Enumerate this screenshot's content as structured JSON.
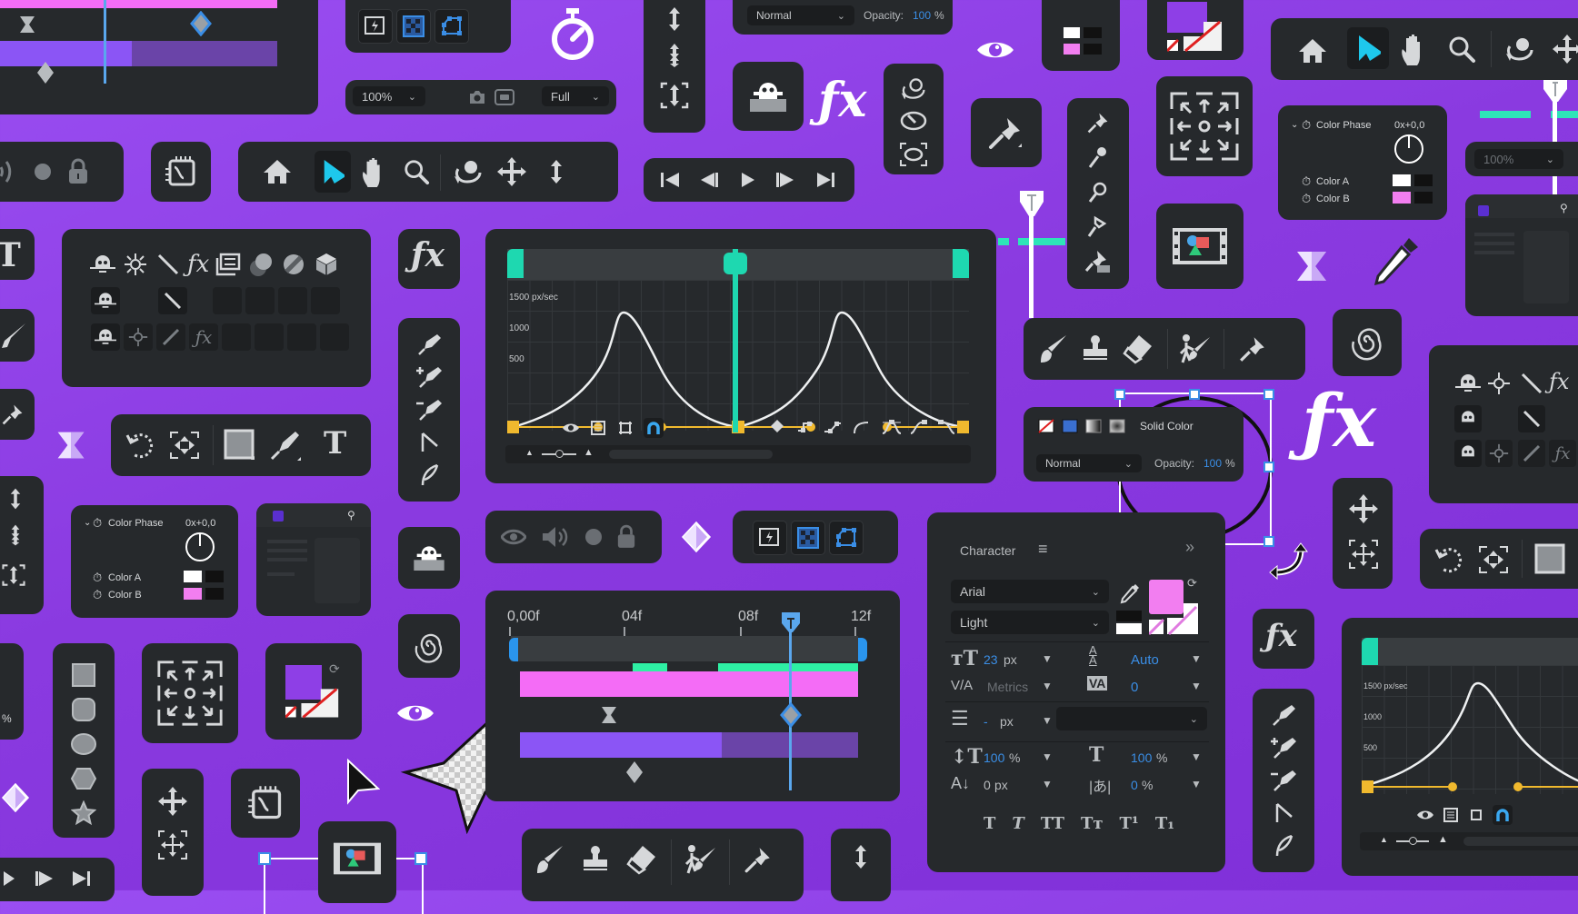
{
  "theme": {
    "background": "#8e3fe6",
    "panel": "#26292c",
    "accent_teal": "#1ed8b0",
    "accent_blue": "#3a8ee6",
    "accent_pink": "#f46cf6",
    "accent_purple": "#8b55f5",
    "accent_yellow": "#f0b92e",
    "selected_tool": "#1ec8ec"
  },
  "blend_panel_top": {
    "mode": "Normal",
    "opacity_label": "Opacity:",
    "opacity_value": "100",
    "opacity_unit": "%"
  },
  "viewer_bar": {
    "zoom": "100%",
    "resolution": "Full"
  },
  "graph_editor": {
    "y_labels": [
      "1500 px/sec",
      "1000",
      "500"
    ]
  },
  "graph_editor_small": {
    "y_labels": [
      "1500 px/sec",
      "1000",
      "500"
    ]
  },
  "fill_panel": {
    "label": "Solid Color",
    "mode": "Normal",
    "opacity_label": "Opacity:",
    "opacity_value": "100",
    "opacity_unit": "%"
  },
  "color_phase_left": {
    "title": "Color Phase",
    "value": "0x+0,0",
    "rows": [
      {
        "label": "Color A",
        "swatch": "#ffffff"
      },
      {
        "label": "Color B",
        "swatch": "#f27ef0"
      }
    ]
  },
  "color_phase_right": {
    "title": "Color Phase",
    "value": "0x+0,0",
    "rows": [
      {
        "label": "Color A",
        "swatch": "#ffffff"
      },
      {
        "label": "Color B",
        "swatch": "#f27ef0"
      }
    ]
  },
  "zoom_select_right": {
    "value": "100%"
  },
  "timeline": {
    "ticks": [
      "0,00f",
      "04f",
      "08f",
      "12f"
    ]
  },
  "character": {
    "title": "Character",
    "font": "Arial",
    "style": "Light",
    "font_size": "23",
    "font_size_unit": "px",
    "leading": "Auto",
    "kerning": "Metrics",
    "tracking": "0",
    "stroke_width": "-",
    "stroke_unit": "px",
    "vertical_scale": "100",
    "vertical_scale_unit": "%",
    "horizontal_scale": "100",
    "horizontal_scale_unit": "%",
    "baseline_shift": "0",
    "baseline_unit": "px",
    "tsume": "0",
    "tsume_unit": "%",
    "fill_color": "#f27ef0",
    "styles": [
      "T",
      "T",
      "TT",
      "Tт",
      "T¹",
      "T₁"
    ]
  },
  "left_edge": {
    "percent": "%"
  }
}
